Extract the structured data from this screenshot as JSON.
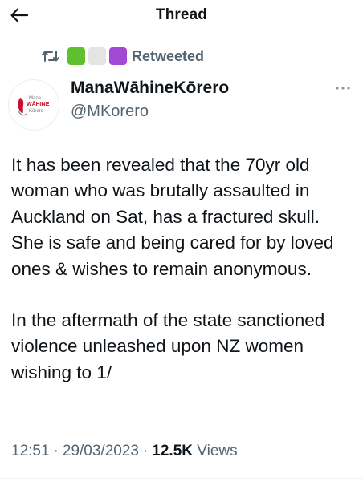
{
  "header": {
    "title": "Thread",
    "back_icon": "arrow-left-icon"
  },
  "social_context": {
    "icon": "retweet-icon",
    "emoji_squares": [
      {
        "name": "green-square-emoji",
        "color": "#5fc02d"
      },
      {
        "name": "white-square-emoji",
        "color": "#e4e4e4"
      },
      {
        "name": "purple-square-emoji",
        "color": "#a24ad6"
      }
    ],
    "label": "Retweeted"
  },
  "author": {
    "display_name": "ManaWāhineKōrero",
    "handle": "@MKorero",
    "avatar": {
      "logo_text_top": "Mana",
      "logo_text_mid": "WĀHINE",
      "logo_text_bottom": "Kōrero",
      "accent_color": "#c8102e"
    }
  },
  "tweet": {
    "paragraph_1": "It has been revealed that the 70yr old woman who was brutally assaulted in Auckland on Sat, has a fractured skull. She is safe and being cared for by loved ones & wishes to remain anonymous.",
    "paragraph_2": "In the aftermath of the state sanctioned violence unleashed upon NZ women wishing to 1/"
  },
  "meta": {
    "time": "12:51",
    "separator": "·",
    "date": "29/03/2023",
    "views_count": "12.5K",
    "views_label": "Views"
  },
  "colors": {
    "text_primary": "#0f1419",
    "text_secondary": "#536471",
    "divider": "#eff3f4"
  }
}
